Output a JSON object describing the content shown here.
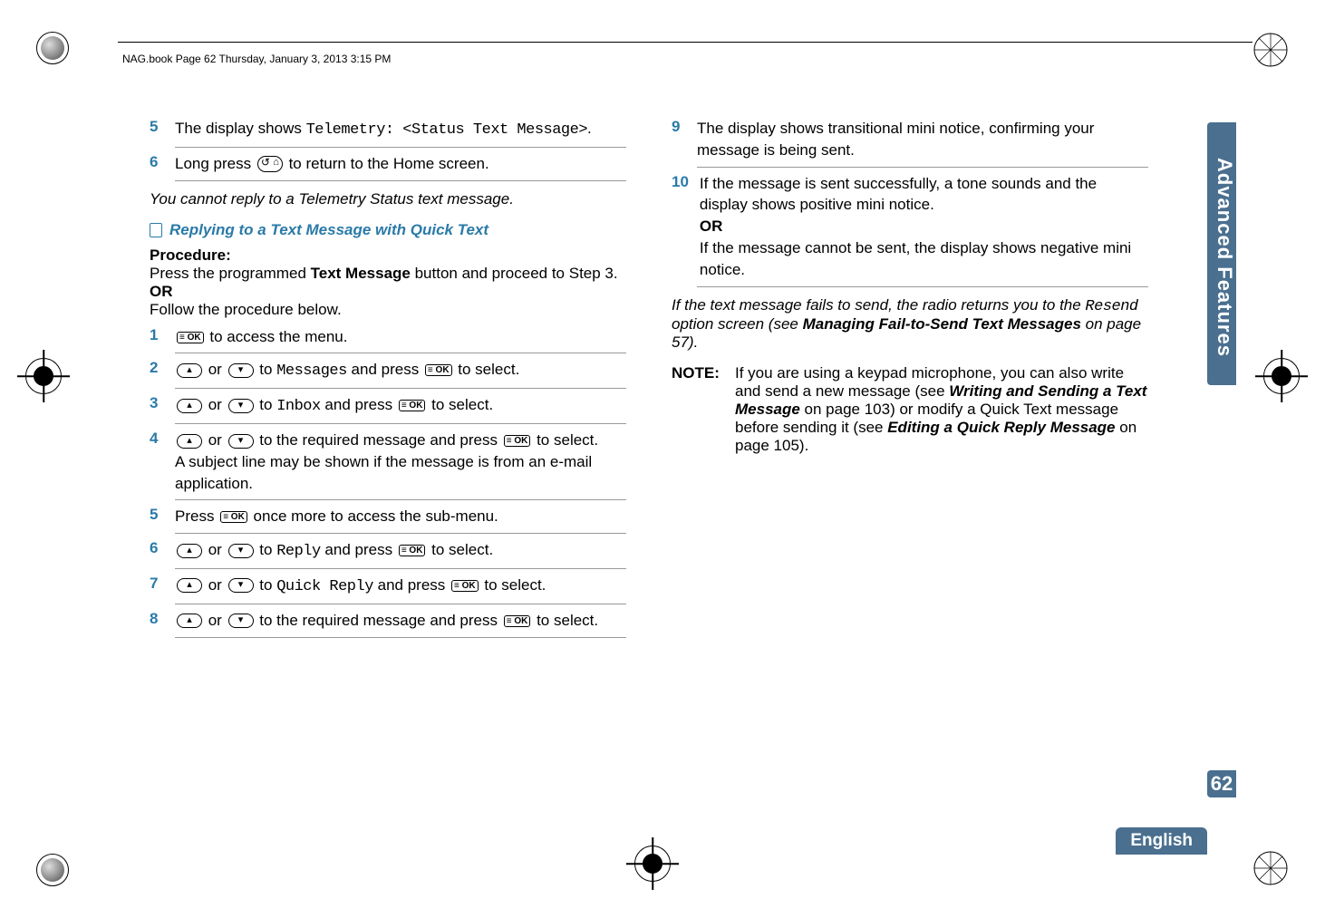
{
  "header": "NAG.book  Page 62  Thursday, January 3, 2013  3:15 PM",
  "side_tab": "Advanced Features",
  "page_number": "62",
  "language": "English",
  "left": {
    "step5": {
      "lead": "The display shows ",
      "code": "Telemetry: <Status Text Message>",
      "tail": "."
    },
    "step6": {
      "lead": "Long press ",
      "tail": " to return to the Home screen."
    },
    "note_italic": "You cannot reply to a Telemetry Status text message.",
    "subheading": "Replying to a Text Message with Quick Text",
    "procedure_label": "Procedure:",
    "proc_line1a": "Press the programmed ",
    "proc_line1b": "Text Message",
    "proc_line1c": " button and proceed to Step 3.",
    "or": "OR",
    "proc_line2": "Follow the procedure below.",
    "s1": " to access the menu.",
    "s2": {
      "a": " or ",
      "b": " to ",
      "code": "Messages",
      "c": " and press ",
      "d": " to select."
    },
    "s3": {
      "a": " or ",
      "b": " to ",
      "code": "Inbox",
      "c": " and press ",
      "d": " to select."
    },
    "s4": {
      "a": " or ",
      "b": " to the required message and press ",
      "c": " to select.",
      "line2": "A subject line may be shown if the message is from an e-mail application."
    },
    "s5": {
      "a": "Press ",
      "b": " once more to access the sub-menu."
    },
    "s6": {
      "a": " or ",
      "b": " to ",
      "code": "Reply",
      "c": " and press ",
      "d": " to select."
    },
    "s7": {
      "a": " or ",
      "b": " to ",
      "code": "Quick Reply",
      "c": " and press ",
      "d": " to select."
    },
    "s8": {
      "a": " or ",
      "b": " to the required message and press ",
      "c": " to select."
    }
  },
  "right": {
    "s9": "The display shows transitional mini notice, confirming your message is being sent.",
    "s10a": "If the message is sent successfully, a tone sounds and the display shows positive mini notice.",
    "or": "OR",
    "s10b": "If the message cannot be sent, the display shows negative mini notice.",
    "italic1": "If the text message fails to send, the radio returns you to the ",
    "italic_code": "Resend",
    "italic2": " option screen (see ",
    "italic_bold": "Managing Fail-to-Send Text Messages",
    "italic3": " on page 57).",
    "note_label": "NOTE:",
    "note_a": "If you are using a keypad microphone, you can also write and send a new message (see ",
    "note_b": "Writing and Sending a Text Message",
    "note_c": " on page 103) or modify a Quick Text message before sending it (see ",
    "note_d": "Editing a Quick Reply Message",
    "note_e": " on page 105)."
  },
  "icons": {
    "ok": "≡ OK",
    "up": "▴",
    "down": "▾"
  }
}
